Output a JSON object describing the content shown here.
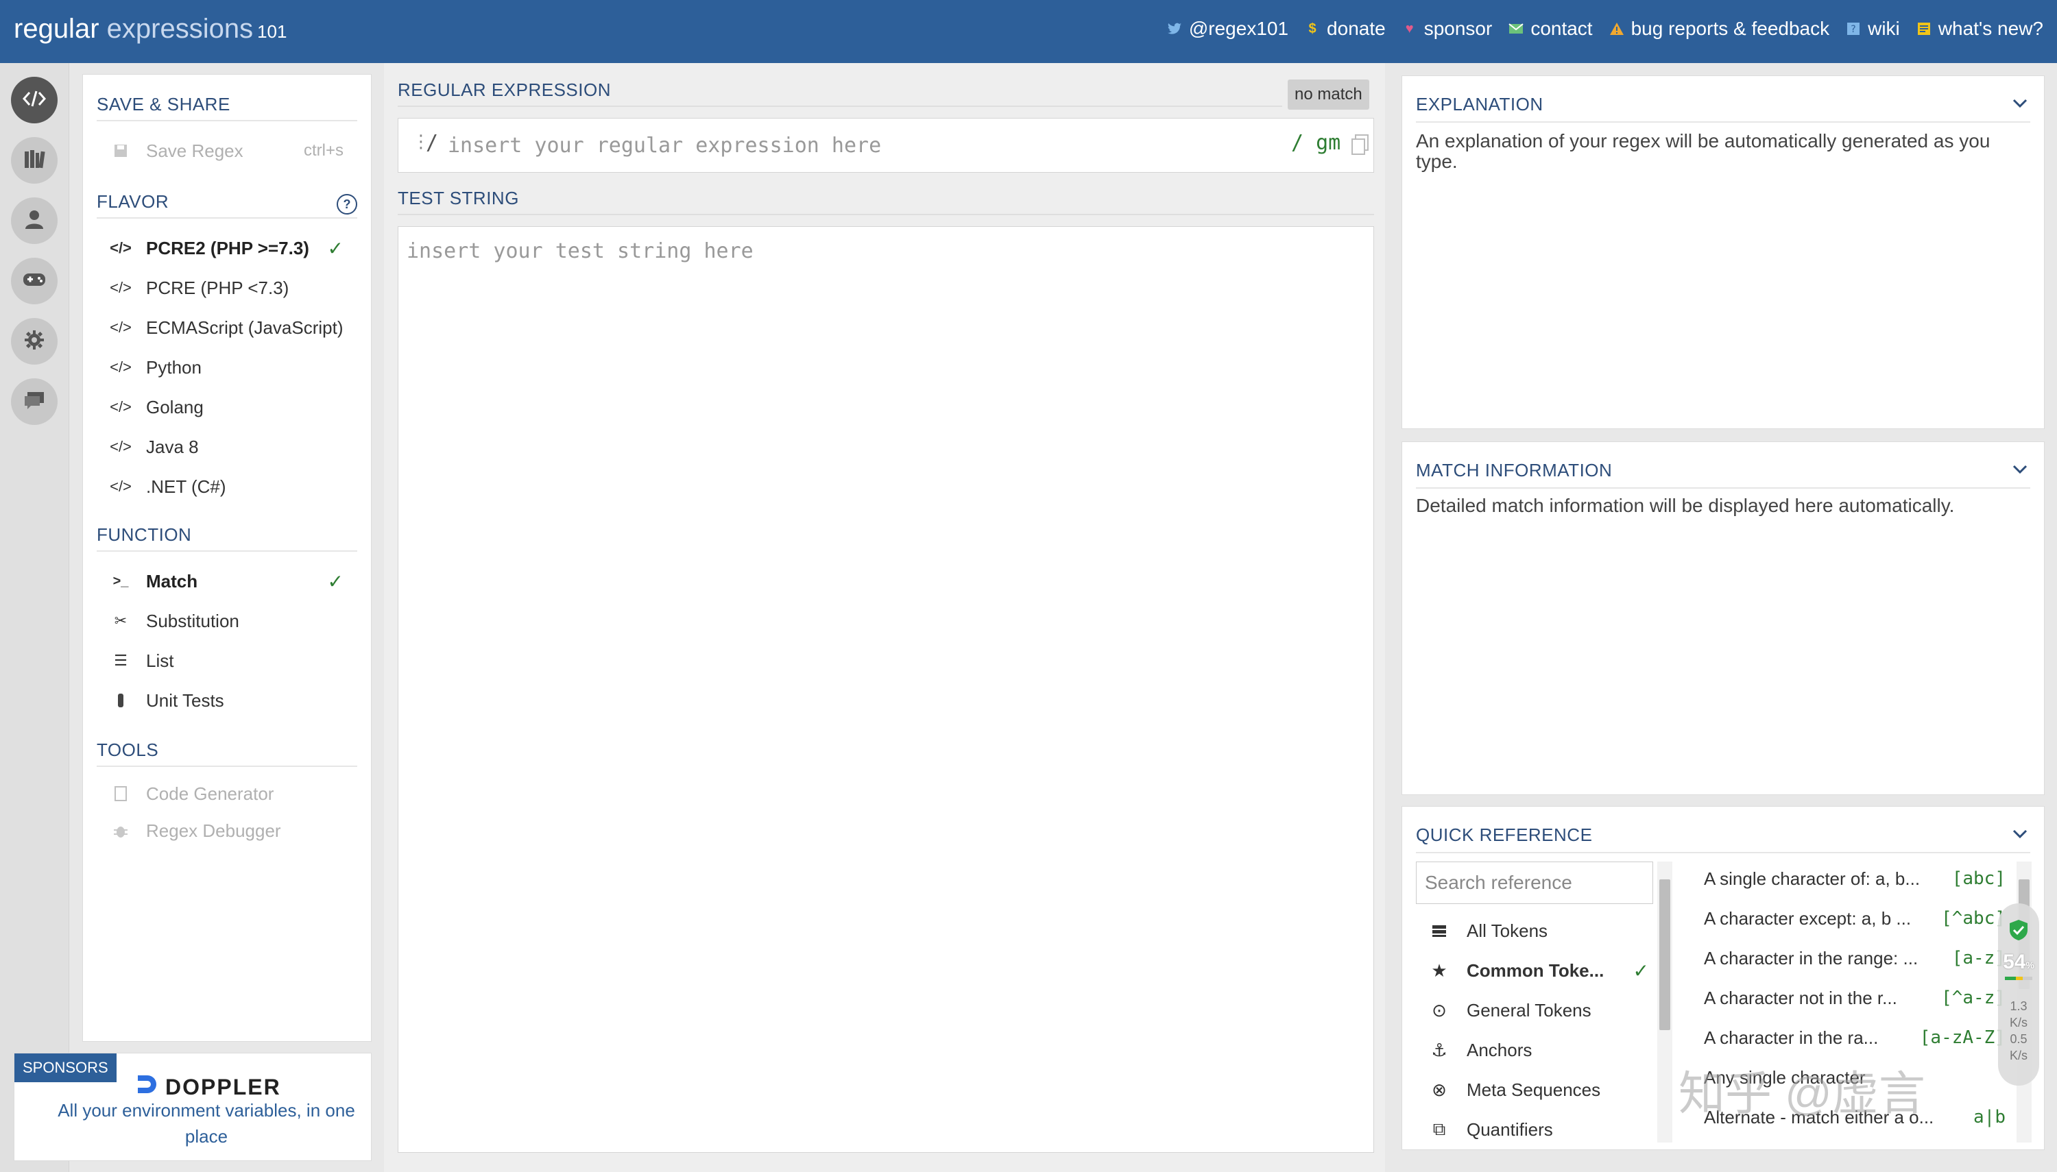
{
  "header": {
    "logo_main": "regular",
    "logo_light": " expressions",
    "logo_num": "101",
    "nav": [
      {
        "label": "@regex101",
        "icon": "twitter-icon"
      },
      {
        "label": "donate",
        "icon": "dollar-icon"
      },
      {
        "label": "sponsor",
        "icon": "heart-icon"
      },
      {
        "label": "contact",
        "icon": "mail-icon"
      },
      {
        "label": "bug reports & feedback",
        "icon": "warning-icon"
      },
      {
        "label": "wiki",
        "icon": "question-icon"
      },
      {
        "label": "what's new?",
        "icon": "newspaper-icon"
      }
    ]
  },
  "rail": [
    "code-icon",
    "library-icon",
    "user-icon",
    "gamepad-icon",
    "gear-icon",
    "chat-icon"
  ],
  "sidebar": {
    "save_share_title": "SAVE & SHARE",
    "save_label": "Save Regex",
    "save_shortcut": "ctrl+s",
    "flavor_title": "FLAVOR",
    "flavors": [
      {
        "label": "PCRE2 (PHP >=7.3)",
        "selected": true
      },
      {
        "label": "PCRE (PHP <7.3)",
        "selected": false
      },
      {
        "label": "ECMAScript (JavaScript)",
        "selected": false
      },
      {
        "label": "Python",
        "selected": false
      },
      {
        "label": "Golang",
        "selected": false
      },
      {
        "label": "Java 8",
        "selected": false
      },
      {
        "label": ".NET (C#)",
        "selected": false
      }
    ],
    "function_title": "FUNCTION",
    "functions": [
      {
        "label": "Match",
        "icon": "terminal-icon",
        "selected": true
      },
      {
        "label": "Substitution",
        "icon": "scissors-icon",
        "selected": false
      },
      {
        "label": "List",
        "icon": "list-icon",
        "selected": false
      },
      {
        "label": "Unit Tests",
        "icon": "flask-icon",
        "selected": false
      }
    ],
    "tools_title": "TOOLS",
    "tools": [
      {
        "label": "Code Generator",
        "icon": "code-file-icon"
      },
      {
        "label": "Regex Debugger",
        "icon": "bug-icon"
      }
    ]
  },
  "sponsor": {
    "badge": "SPONSORS",
    "brand": "DOPPLER",
    "tagline": "All your environment variables, in one place"
  },
  "editor": {
    "regex_title": "REGULAR EXPRESSION",
    "status": "no match",
    "delim_open": "/",
    "regex_placeholder": "insert your regular expression here",
    "flags": "/ gm",
    "test_title": "TEST STRING",
    "test_placeholder": "insert your test string here"
  },
  "explanation": {
    "title": "EXPLANATION",
    "text": "An explanation of your regex will be automatically generated as you type."
  },
  "match_info": {
    "title": "MATCH INFORMATION",
    "text": "Detailed match information will be displayed here automatically."
  },
  "quick_ref": {
    "title": "QUICK REFERENCE",
    "search_placeholder": "Search reference",
    "categories": [
      {
        "label": "All Tokens",
        "icon": "stack-icon",
        "selected": false
      },
      {
        "label": "Common Toke...",
        "icon": "star-icon",
        "selected": true
      },
      {
        "label": "General Tokens",
        "icon": "target-icon",
        "selected": false
      },
      {
        "label": "Anchors",
        "icon": "anchor-icon",
        "selected": false
      },
      {
        "label": "Meta Sequences",
        "icon": "meta-icon",
        "selected": false
      },
      {
        "label": "Quantifiers",
        "icon": "quantifier-icon",
        "selected": false
      }
    ],
    "rows": [
      {
        "desc": "A single character of: a, b...",
        "token": "[abc]"
      },
      {
        "desc": "A character except: a, b ...",
        "token": "[^abc]"
      },
      {
        "desc": "A character in the range: ...",
        "token": "[a-z]"
      },
      {
        "desc": "A character not in the r...",
        "token": "[^a-z]"
      },
      {
        "desc": "A character in the ra...",
        "token": "[a-zA-Z]"
      },
      {
        "desc": "Any single character",
        "token": ""
      },
      {
        "desc": "Alternate - match either a o...",
        "token": "a|b"
      }
    ]
  },
  "speed_widget": {
    "percent": "54",
    "unit": "%",
    "up": "1.3",
    "down": "0.5",
    "rate_unit": "K/s"
  },
  "watermark": "知乎 @虚言"
}
